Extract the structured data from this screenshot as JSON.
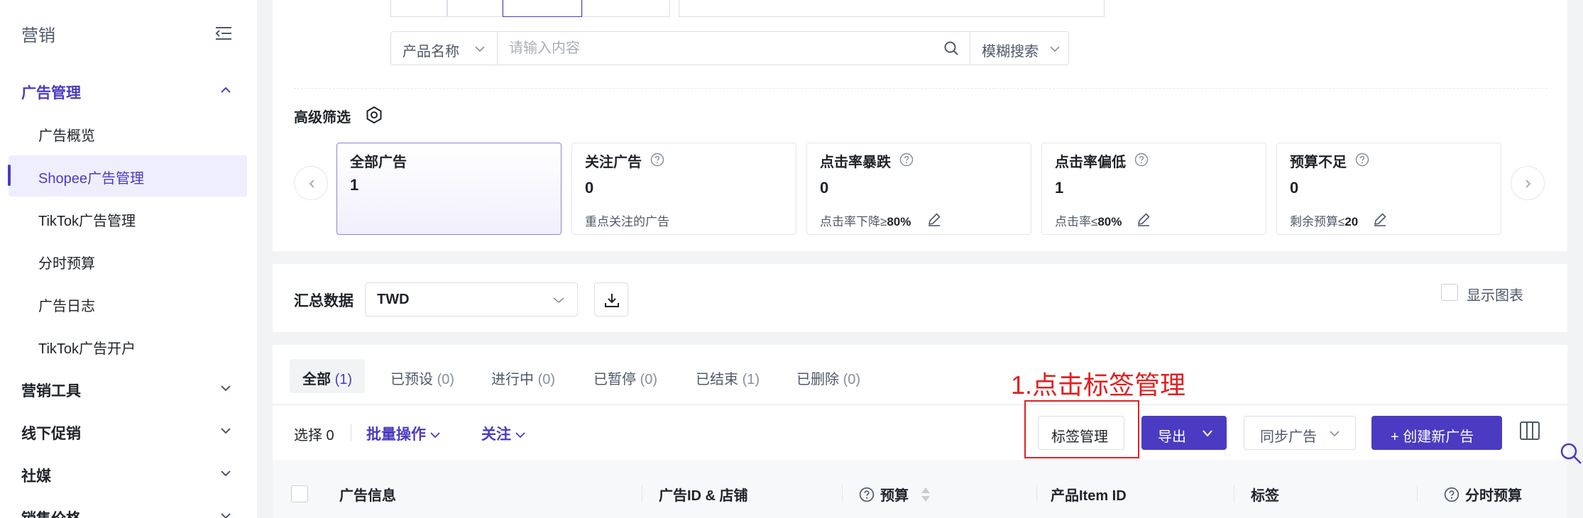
{
  "sidebar": {
    "title": "营销",
    "groups": [
      {
        "label": "广告管理"
      },
      {
        "label": "营销工具"
      },
      {
        "label": "线下促销"
      },
      {
        "label": "社媒"
      },
      {
        "label": "销售价格"
      }
    ],
    "items": [
      {
        "label": "广告概览"
      },
      {
        "label": "Shopee广告管理"
      },
      {
        "label": "TikTok广告管理"
      },
      {
        "label": "分时预算"
      },
      {
        "label": "广告日志"
      },
      {
        "label": "TikTok广告开户"
      }
    ]
  },
  "search": {
    "field": "产品名称",
    "placeholder": "请输入内容",
    "mode": "模糊搜索"
  },
  "advanced": {
    "title": "高级筛选",
    "cards": [
      {
        "title": "全部广告",
        "count": "1",
        "desc": ""
      },
      {
        "title": "关注广告",
        "count": "0",
        "desc": "重点关注的广告"
      },
      {
        "title": "点击率暴跌",
        "count": "0",
        "desc_prefix": "点击率下降≥",
        "desc_value": "80%"
      },
      {
        "title": "点击率偏低",
        "count": "1",
        "desc_prefix": "点击率≤",
        "desc_value": "80%"
      },
      {
        "title": "预算不足",
        "count": "0",
        "desc_prefix": "剩余预算≤",
        "desc_value": "20"
      }
    ]
  },
  "summary": {
    "title": "汇总数据",
    "currency": "TWD",
    "show_chart_label": "显示图表"
  },
  "tabs": [
    {
      "label": "全部",
      "count": "(1)"
    },
    {
      "label": "已预设",
      "count": "(0)"
    },
    {
      "label": "进行中",
      "count": "(0)"
    },
    {
      "label": "已暂停",
      "count": "(0)"
    },
    {
      "label": "已结束",
      "count": "(1)"
    },
    {
      "label": "已删除",
      "count": "(0)"
    }
  ],
  "annotation": "1.点击标签管理",
  "toolbar": {
    "selected": "选择 0",
    "batch": "批量操作",
    "follow": "关注",
    "tag_manage": "标签管理",
    "export": "导出",
    "sync": "同步广告",
    "create": "+ 创建新广告"
  },
  "table": {
    "headers": [
      "广告信息",
      "广告ID & 店铺",
      "预算",
      "产品Item ID",
      "标签",
      "分时预算"
    ]
  },
  "colors": {
    "primary": "#4a3bc2",
    "annotation_red": "#e02020"
  }
}
